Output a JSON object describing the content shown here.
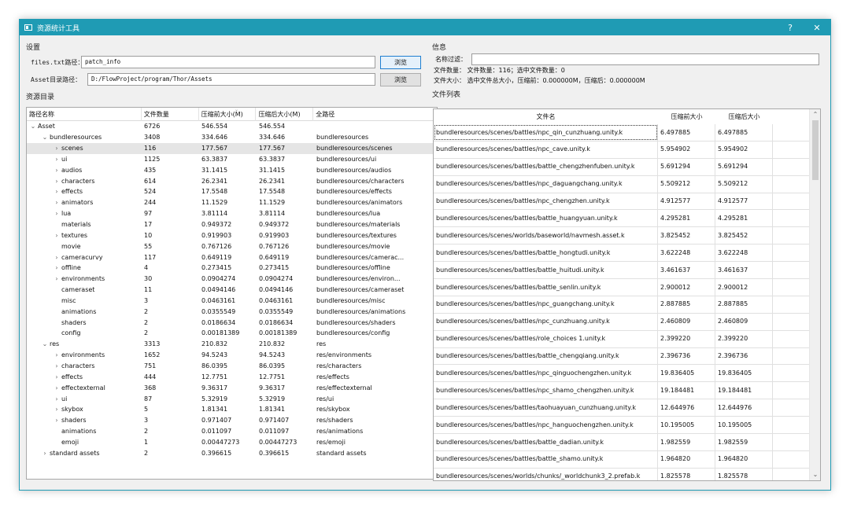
{
  "window": {
    "title": "资源统计工具",
    "help": "?",
    "close": "✕"
  },
  "settings": {
    "group_label": "设置",
    "files_label": "files.txt路径：",
    "files_value": "patch_info",
    "asset_label": "Asset目录路径：",
    "asset_value": "D:/FlowProject/program/Thor/Assets",
    "browse1": "浏览",
    "browse2": "浏览"
  },
  "tree": {
    "group_label": "资源目录",
    "headers": [
      "路径名称",
      "文件数量",
      "压缩前大小(M)",
      "压缩后大小(M)",
      "全路径"
    ],
    "rows": [
      {
        "indent": 0,
        "arrow": "⌄",
        "name": "Asset",
        "count": "6726",
        "before": "546.554",
        "after": "546.554",
        "path": ""
      },
      {
        "indent": 1,
        "arrow": "⌄",
        "name": "bundleresources",
        "count": "3408",
        "before": "334.646",
        "after": "334.646",
        "path": "bundleresources"
      },
      {
        "indent": 2,
        "arrow": "›",
        "name": "scenes",
        "count": "116",
        "before": "177.567",
        "after": "177.567",
        "path": "bundleresources/scenes",
        "selected": true
      },
      {
        "indent": 2,
        "arrow": "›",
        "name": "ui",
        "count": "1125",
        "before": "63.3837",
        "after": "63.3837",
        "path": "bundleresources/ui"
      },
      {
        "indent": 2,
        "arrow": "›",
        "name": "audios",
        "count": "435",
        "before": "31.1415",
        "after": "31.1415",
        "path": "bundleresources/audios"
      },
      {
        "indent": 2,
        "arrow": "›",
        "name": "characters",
        "count": "614",
        "before": "26.2341",
        "after": "26.2341",
        "path": "bundleresources/characters"
      },
      {
        "indent": 2,
        "arrow": "›",
        "name": "effects",
        "count": "524",
        "before": "17.5548",
        "after": "17.5548",
        "path": "bundleresources/effects"
      },
      {
        "indent": 2,
        "arrow": "›",
        "name": "animators",
        "count": "244",
        "before": "11.1529",
        "after": "11.1529",
        "path": "bundleresources/animators"
      },
      {
        "indent": 2,
        "arrow": "›",
        "name": "lua",
        "count": "97",
        "before": "3.81114",
        "after": "3.81114",
        "path": "bundleresources/lua"
      },
      {
        "indent": 2,
        "arrow": "",
        "name": "materials",
        "count": "17",
        "before": "0.949372",
        "after": "0.949372",
        "path": "bundleresources/materials"
      },
      {
        "indent": 2,
        "arrow": "›",
        "name": "textures",
        "count": "10",
        "before": "0.919903",
        "after": "0.919903",
        "path": "bundleresources/textures"
      },
      {
        "indent": 2,
        "arrow": "",
        "name": "movie",
        "count": "55",
        "before": "0.767126",
        "after": "0.767126",
        "path": "bundleresources/movie"
      },
      {
        "indent": 2,
        "arrow": "›",
        "name": "cameracurvy",
        "count": "117",
        "before": "0.649119",
        "after": "0.649119",
        "path": "bundleresources/camerac..."
      },
      {
        "indent": 2,
        "arrow": "›",
        "name": "offline",
        "count": "4",
        "before": "0.273415",
        "after": "0.273415",
        "path": "bundleresources/offline"
      },
      {
        "indent": 2,
        "arrow": "›",
        "name": "environments",
        "count": "30",
        "before": "0.0904274",
        "after": "0.0904274",
        "path": "bundleresources/environ..."
      },
      {
        "indent": 2,
        "arrow": "",
        "name": "cameraset",
        "count": "11",
        "before": "0.0494146",
        "after": "0.0494146",
        "path": "bundleresources/cameraset"
      },
      {
        "indent": 2,
        "arrow": "",
        "name": "misc",
        "count": "3",
        "before": "0.0463161",
        "after": "0.0463161",
        "path": "bundleresources/misc"
      },
      {
        "indent": 2,
        "arrow": "",
        "name": "animations",
        "count": "2",
        "before": "0.0355549",
        "after": "0.0355549",
        "path": "bundleresources/animations"
      },
      {
        "indent": 2,
        "arrow": "",
        "name": "shaders",
        "count": "2",
        "before": "0.0186634",
        "after": "0.0186634",
        "path": "bundleresources/shaders"
      },
      {
        "indent": 2,
        "arrow": "",
        "name": "config",
        "count": "2",
        "before": "0.00181389",
        "after": "0.00181389",
        "path": "bundleresources/config"
      },
      {
        "indent": 1,
        "arrow": "⌄",
        "name": "res",
        "count": "3313",
        "before": "210.832",
        "after": "210.832",
        "path": "res"
      },
      {
        "indent": 2,
        "arrow": "›",
        "name": "environments",
        "count": "1652",
        "before": "94.5243",
        "after": "94.5243",
        "path": "res/environments"
      },
      {
        "indent": 2,
        "arrow": "›",
        "name": "characters",
        "count": "751",
        "before": "86.0395",
        "after": "86.0395",
        "path": "res/characters"
      },
      {
        "indent": 2,
        "arrow": "›",
        "name": "effects",
        "count": "444",
        "before": "12.7751",
        "after": "12.7751",
        "path": "res/effects"
      },
      {
        "indent": 2,
        "arrow": "›",
        "name": "effectexternal",
        "count": "368",
        "before": "9.36317",
        "after": "9.36317",
        "path": "res/effectexternal"
      },
      {
        "indent": 2,
        "arrow": "›",
        "name": "ui",
        "count": "87",
        "before": "5.32919",
        "after": "5.32919",
        "path": "res/ui"
      },
      {
        "indent": 2,
        "arrow": "›",
        "name": "skybox",
        "count": "5",
        "before": "1.81341",
        "after": "1.81341",
        "path": "res/skybox"
      },
      {
        "indent": 2,
        "arrow": "›",
        "name": "shaders",
        "count": "3",
        "before": "0.971407",
        "after": "0.971407",
        "path": "res/shaders"
      },
      {
        "indent": 2,
        "arrow": "",
        "name": "animations",
        "count": "2",
        "before": "0.011097",
        "after": "0.011097",
        "path": "res/animations"
      },
      {
        "indent": 2,
        "arrow": "",
        "name": "emoji",
        "count": "1",
        "before": "0.00447273",
        "after": "0.00447273",
        "path": "res/emoji"
      },
      {
        "indent": 1,
        "arrow": "›",
        "name": "standard assets",
        "count": "2",
        "before": "0.396615",
        "after": "0.396615",
        "path": "standard assets"
      }
    ]
  },
  "info": {
    "group_label": "信息",
    "filter_label": "名称过滤：",
    "filter_value": "",
    "file_count": "文件数量： 文件数量：116；选中文件数量：0",
    "file_size": "文件大小： 选中文件总大小，压缩前：0.000000M，压缩后：0.000000M"
  },
  "files": {
    "group_label": "文件列表",
    "headers": [
      "文件名",
      "压缩前大小",
      "压缩后大小"
    ],
    "rows": [
      {
        "name": "bundleresources/scenes/battles/npc_qin_cunzhuang.unity.k",
        "before": "6.497885",
        "after": "6.497885"
      },
      {
        "name": "bundleresources/scenes/battles/npc_cave.unity.k",
        "before": "5.954902",
        "after": "5.954902"
      },
      {
        "name": "bundleresources/scenes/battles/battle_chengzhenfuben.unity.k",
        "before": "5.691294",
        "after": "5.691294"
      },
      {
        "name": "bundleresources/scenes/battles/npc_daguangchang.unity.k",
        "before": "5.509212",
        "after": "5.509212"
      },
      {
        "name": "bundleresources/scenes/battles/npc_chengzhen.unity.k",
        "before": "4.912577",
        "after": "4.912577"
      },
      {
        "name": "bundleresources/scenes/battles/battle_huangyuan.unity.k",
        "before": "4.295281",
        "after": "4.295281"
      },
      {
        "name": "bundleresources/scenes/worlds/baseworld/navmesh.asset.k",
        "before": "3.825452",
        "after": "3.825452"
      },
      {
        "name": "bundleresources/scenes/battles/battle_hongtudi.unity.k",
        "before": "3.622248",
        "after": "3.622248"
      },
      {
        "name": "bundleresources/scenes/battles/battle_huitudi.unity.k",
        "before": "3.461637",
        "after": "3.461637"
      },
      {
        "name": "bundleresources/scenes/battles/battle_senlin.unity.k",
        "before": "2.900012",
        "after": "2.900012"
      },
      {
        "name": "bundleresources/scenes/battles/npc_guangchang.unity.k",
        "before": "2.887885",
        "after": "2.887885"
      },
      {
        "name": "bundleresources/scenes/battles/npc_cunzhuang.unity.k",
        "before": "2.460809",
        "after": "2.460809"
      },
      {
        "name": "bundleresources/scenes/battles/role_choices 1.unity.k",
        "before": "2.399220",
        "after": "2.399220"
      },
      {
        "name": "bundleresources/scenes/battles/battle_chengqiang.unity.k",
        "before": "2.396736",
        "after": "2.396736"
      },
      {
        "name": "bundleresources/scenes/battles/npc_qinguochengzhen.unity.k",
        "before": "19.836405",
        "after": "19.836405"
      },
      {
        "name": "bundleresources/scenes/battles/npc_shamo_chengzhen.unity.k",
        "before": "19.184481",
        "after": "19.184481"
      },
      {
        "name": "bundleresources/scenes/battles/taohuayuan_cunzhuang.unity.k",
        "before": "12.644976",
        "after": "12.644976"
      },
      {
        "name": "bundleresources/scenes/battles/npc_hanguochengzhen.unity.k",
        "before": "10.195005",
        "after": "10.195005"
      },
      {
        "name": "bundleresources/scenes/battles/battle_dadian.unity.k",
        "before": "1.982559",
        "after": "1.982559"
      },
      {
        "name": "bundleresources/scenes/battles/battle_shamo.unity.k",
        "before": "1.964820",
        "after": "1.964820"
      },
      {
        "name": "bundleresources/scenes/worlds/chunks/_worldchunk3_2.prefab.k",
        "before": "1.825578",
        "after": "1.825578"
      }
    ]
  }
}
